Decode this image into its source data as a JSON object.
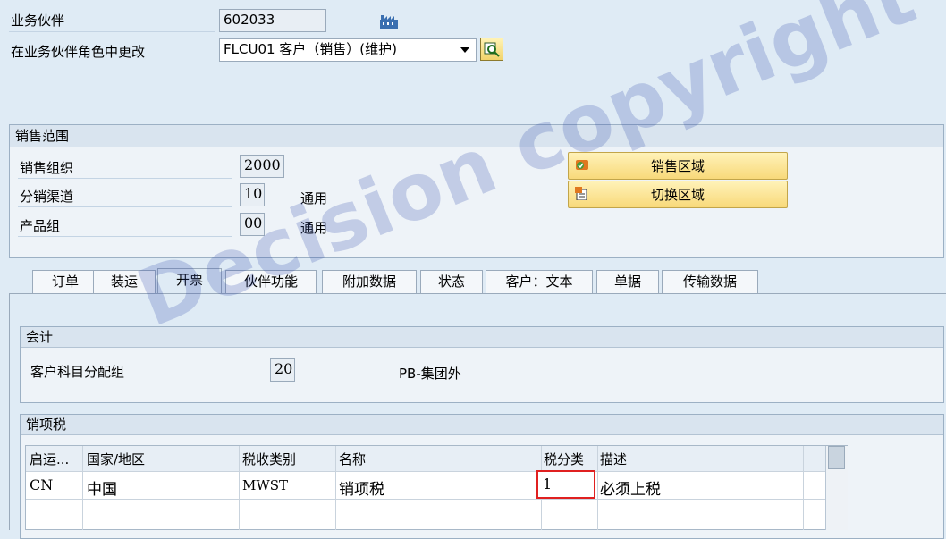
{
  "header": {
    "bp_label": "业务伙伴",
    "bp_value": "602033",
    "role_label": "在业务伙伴角色中更改",
    "role_value": "FLCU01 客户（销售）(维护)"
  },
  "sales_area": {
    "title": "销售范围",
    "org_label": "销售组织",
    "org_value": "2000",
    "channel_label": "分销渠道",
    "channel_value": "10",
    "channel_desc": "通用",
    "division_label": "产品组",
    "division_value": "00",
    "division_desc": "通用",
    "btn_sales_area": "销售区域",
    "btn_switch_area": "切换区域"
  },
  "tabs": [
    {
      "label": "订单"
    },
    {
      "label": "装运"
    },
    {
      "label": "开票"
    },
    {
      "label": "伙伴功能"
    },
    {
      "label": "附加数据"
    },
    {
      "label": "状态"
    },
    {
      "label": "客户：文本"
    },
    {
      "label": "单据"
    },
    {
      "label": "传输数据"
    }
  ],
  "accounting": {
    "title": "会计",
    "acct_label": "客户科目分配组",
    "acct_value": "20",
    "acct_desc": "PB-集团外"
  },
  "output_tax": {
    "title": "销项税",
    "columns": [
      "启运...",
      "国家/地区",
      "税收类别",
      "名称",
      "税分类",
      "描述"
    ],
    "rows": [
      {
        "dep": "CN",
        "country": "中国",
        "tax_cat": "MWST",
        "name": "销项税",
        "tax_class": "1",
        "desc": "必须上税"
      }
    ]
  },
  "watermark": "Decision copyright"
}
